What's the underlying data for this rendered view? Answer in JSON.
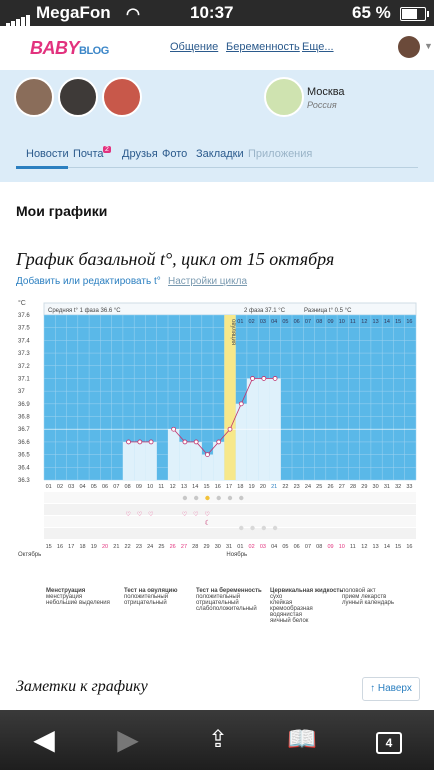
{
  "status_bar": {
    "carrier": "MegaFon",
    "time": "10:37",
    "battery": "65 %"
  },
  "site": {
    "logo": "BABY",
    "logo_suffix": "BLOG",
    "nav": [
      "Общение",
      "Беременность",
      "Еще..."
    ]
  },
  "profile": {
    "city": "Москва",
    "country": "Россия",
    "tabs": [
      "Новости",
      "Почта",
      "Друзья",
      "Фото",
      "Закладки",
      "Приложения"
    ],
    "mail_badge": "2"
  },
  "page": {
    "section_title": "Мои графики",
    "chart_title": "График базальной t°, цикл от 15 октября",
    "add_link": "Добавить или редактировать t°",
    "settings_link": "Настройки цикла",
    "notes_title": "Заметки к графику",
    "up_button": "↑ Наверх"
  },
  "chart_data": {
    "type": "line",
    "y_unit": "°C",
    "ylim": [
      36.3,
      37.6
    ],
    "y_ticks": [
      "37.6",
      "37.5",
      "37.4",
      "37.3",
      "37.2",
      "37.1",
      "37",
      "36.9",
      "36.8",
      "36.7",
      "36.6",
      "36.5",
      "36.4",
      "36.3"
    ],
    "phase1_label": "Средняя t° 1 фаза 36.6 °C",
    "phase2_label": "2 фаза 37.1 °C",
    "diff_label": "Разница t° 0.5 °C",
    "ovulation_label": "овуляция",
    "day_numbers": [
      "01",
      "02",
      "03",
      "04",
      "05",
      "06",
      "07",
      "08",
      "09",
      "10",
      "11",
      "12",
      "13",
      "14",
      "15",
      "16",
      "17",
      "18",
      "19",
      "20",
      "21",
      "22",
      "23",
      "24",
      "25",
      "26",
      "27",
      "28",
      "29",
      "30",
      "31",
      "32",
      "33"
    ],
    "phase2_days": [
      "01",
      "02",
      "03",
      "04",
      "05",
      "06",
      "07",
      "08",
      "09",
      "10",
      "11",
      "12",
      "13",
      "14",
      "15",
      "16"
    ],
    "temps": [
      null,
      null,
      null,
      null,
      null,
      null,
      null,
      36.6,
      36.6,
      36.6,
      null,
      36.7,
      36.6,
      36.6,
      36.5,
      36.6,
      36.7,
      36.9,
      37.1,
      37.1,
      37.1,
      null,
      null,
      null,
      null,
      null,
      null,
      null,
      null,
      null,
      null,
      null,
      null
    ],
    "dates": [
      "15",
      "16",
      "17",
      "18",
      "19",
      "20",
      "21",
      "22",
      "23",
      "24",
      "25",
      "26",
      "27",
      "28",
      "29",
      "30",
      "31",
      "01",
      "02",
      "03",
      "04",
      "05",
      "06",
      "07",
      "08",
      "09",
      "10",
      "11",
      "12",
      "13",
      "14",
      "15",
      "16"
    ],
    "month_start": "Октябрь",
    "month_next": "Ноябрь",
    "average_line": 36.7
  },
  "legend": {
    "menstruation": {
      "title": "Менструация",
      "items": [
        "менструация",
        "небольшие выделения"
      ]
    },
    "ovulation_test": {
      "title": "Тест на овуляцию",
      "items": [
        "положительный",
        "отрицательный"
      ]
    },
    "pregnancy_test": {
      "title": "Тест на беременность",
      "items": [
        "положительный",
        "отрицательный",
        "слабоположительный"
      ]
    },
    "cervical": {
      "title": "Цервикальная жидкость",
      "items": [
        "сухо",
        "клейкая",
        "кремообразная",
        "водянистая",
        "яичный белок"
      ]
    },
    "other": {
      "items": [
        "половой акт",
        "прием лекарств",
        "лунный календарь"
      ]
    }
  }
}
